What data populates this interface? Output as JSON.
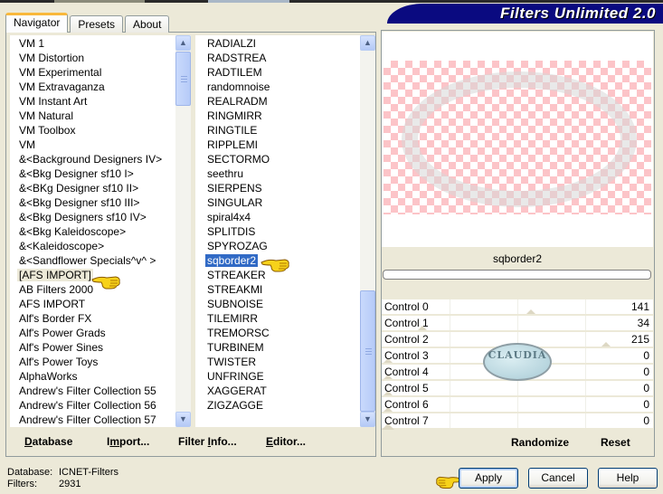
{
  "app": {
    "title": "Filters Unlimited 2.0"
  },
  "tabs": [
    {
      "label": "Navigator",
      "active": true
    },
    {
      "label": "Presets",
      "active": false
    },
    {
      "label": "About",
      "active": false
    }
  ],
  "categories": {
    "items": [
      "VM 1",
      "VM Distortion",
      "VM Experimental",
      "VM Extravaganza",
      "VM Instant Art",
      "VM Natural",
      "VM Toolbox",
      "VM",
      "&<Background Designers IV>",
      "&<Bkg Designer sf10 I>",
      "&<BKg Designer sf10 II>",
      "&<Bkg Designer sf10 III>",
      "&<Bkg Designers sf10 IV>",
      "&<Bkg Kaleidoscope>",
      "&<Kaleidoscope>",
      "&<Sandflower Specials^v^ >",
      "[AFS IMPORT]",
      "AB Filters 2000",
      "AFS IMPORT",
      "Alf's Border FX",
      "Alf's Power Grads",
      "Alf's Power Sines",
      "Alf's Power Toys",
      "AlphaWorks",
      "Andrew's Filter Collection 55",
      "Andrew's Filter Collection 56",
      "Andrew's Filter Collection 57"
    ],
    "highlighted": "[AFS IMPORT]"
  },
  "filters": {
    "items": [
      "RADIALZI",
      "RADSTREA",
      "RADTILEM",
      "randomnoise",
      "REALRADM",
      "RINGMIRR",
      "RINGTILE",
      "RIPPLEMI",
      "SECTORMO",
      "seethru",
      "SIERPENS",
      "SINGULAR",
      "spiral4x4",
      "SPLITDIS",
      "SPYROZAG",
      "sqborder2",
      "STREAKER",
      "STREAKMI",
      "SUBNOISE",
      "TILEMIRR",
      "TREMORSC",
      "TURBINEM",
      "TWISTER",
      "UNFRINGE",
      "XAGGERAT",
      "ZIGZAGGE"
    ],
    "selected": "sqborder2"
  },
  "navigator_buttons": {
    "database": "Database",
    "import": "Import...",
    "filter_info": "Filter Info...",
    "editor": "Editor..."
  },
  "status": {
    "database_label": "Database:",
    "database_value": "ICNET-Filters",
    "filters_label": "Filters:",
    "filters_value": "2931"
  },
  "preview": {
    "filter_name": "sqborder2",
    "progress": 0
  },
  "controls": [
    {
      "label": "Control 0",
      "value": 141
    },
    {
      "label": "Control 1",
      "value": 34
    },
    {
      "label": "Control 2",
      "value": 215
    },
    {
      "label": "Control 3",
      "value": 0
    },
    {
      "label": "Control 4",
      "value": 0
    },
    {
      "label": "Control 5",
      "value": 0
    },
    {
      "label": "Control 6",
      "value": 0
    },
    {
      "label": "Control 7",
      "value": 0
    }
  ],
  "control_range": {
    "min": 0,
    "max": 255
  },
  "watermark": {
    "text": "CLAUDIA"
  },
  "preview_buttons": {
    "randomize": "Randomize",
    "reset": "Reset"
  },
  "dialog_buttons": {
    "apply": "Apply",
    "cancel": "Cancel",
    "help": "Help"
  },
  "colors": {
    "selection": "#316ac5",
    "brand_bar": "#0a0a80",
    "tab_accent": "#f9b83c",
    "checker": "#fcc4c8"
  }
}
